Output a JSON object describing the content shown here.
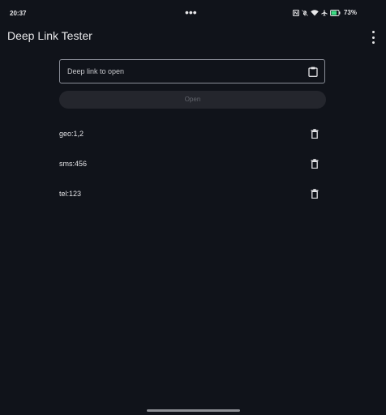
{
  "status_bar": {
    "time": "20:37",
    "dots": "•••",
    "battery_percent": "73%",
    "icons": [
      "nfc-icon",
      "bell-off-icon",
      "wifi-icon",
      "airplane-icon",
      "battery-icon"
    ]
  },
  "app_bar": {
    "title": "Deep Link Tester",
    "menu_icon": "more-vert-icon"
  },
  "input": {
    "placeholder": "Deep link to open",
    "value": "",
    "paste_icon": "clipboard-icon"
  },
  "open_button": {
    "label": "Open",
    "enabled": false
  },
  "history": [
    {
      "label": "geo:1,2",
      "icon": "trash-icon"
    },
    {
      "label": "sms:456",
      "icon": "trash-icon"
    },
    {
      "label": "tel:123",
      "icon": "trash-icon"
    }
  ],
  "colors": {
    "background": "#10131a",
    "text": "#e3e3e6",
    "outline": "#8b8f99",
    "button_disabled_bg": "#24262d",
    "button_disabled_text": "#62656c",
    "battery_fill": "#3ddc84"
  }
}
